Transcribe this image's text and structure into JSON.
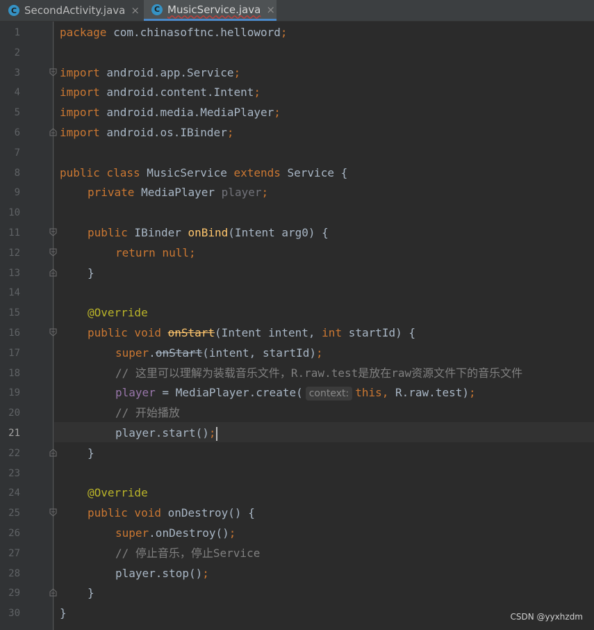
{
  "tabs": [
    {
      "label": "SecondActivity.java",
      "icon": "java-class-icon",
      "icon_letter": "C",
      "close": "×",
      "active": false
    },
    {
      "label": "MusicService.java",
      "icon": "java-class-icon",
      "icon_letter": "C",
      "close": "×",
      "active": true
    }
  ],
  "current_line": 21,
  "line_numbers": [
    "1",
    "2",
    "3",
    "4",
    "5",
    "6",
    "7",
    "8",
    "9",
    "10",
    "11",
    "12",
    "13",
    "14",
    "15",
    "16",
    "17",
    "18",
    "19",
    "20",
    "21",
    "22",
    "23",
    "24",
    "25",
    "26",
    "27",
    "28",
    "29",
    "30"
  ],
  "code": {
    "l1": [
      "package",
      " com.chinasoftnc.helloword",
      ";"
    ],
    "l3": [
      "import",
      " android.app.Service",
      ";"
    ],
    "l4": [
      "import",
      " android.content.Intent",
      ";"
    ],
    "l5": [
      "import",
      " android.media.MediaPlayer",
      ";"
    ],
    "l6": [
      "import",
      " android.os.IBinder",
      ";"
    ],
    "l8": [
      "public class",
      " MusicService ",
      "extends",
      " Service {"
    ],
    "l9": [
      "private",
      " MediaPlayer ",
      "player",
      ";"
    ],
    "l11": [
      "public",
      " IBinder ",
      "onBind",
      "(Intent arg0) {"
    ],
    "l12": [
      "return null;"
    ],
    "l13": [
      "}"
    ],
    "l15": [
      "@Override"
    ],
    "l16": [
      "public void",
      " ",
      "onStart",
      "(Intent intent, ",
      "int",
      " startId) {"
    ],
    "l17": [
      "super",
      ".",
      "onStart",
      "(intent, startId)",
      ";"
    ],
    "l18": [
      "// 这里可以理解为装载音乐文件，R.raw.test是放在raw资源文件下的音乐文件"
    ],
    "l19": [
      "player",
      " = MediaPlayer.create(",
      "context:",
      "this,",
      " R.raw.test)",
      ";"
    ],
    "l20": [
      "// 开始播放"
    ],
    "l21": [
      "player.start()",
      ";"
    ],
    "l22": [
      "}"
    ],
    "l24": [
      "@Override"
    ],
    "l25": [
      "public void",
      " onDestroy() {"
    ],
    "l26": [
      "super",
      ".onDestroy()",
      ";"
    ],
    "l27": [
      "// 停止音乐，停止Service"
    ],
    "l28": [
      "player.stop()",
      ";"
    ],
    "l29": [
      "}"
    ],
    "l30": [
      "}"
    ]
  },
  "watermark": "CSDN @yyxhzdm",
  "colors": {
    "background": "#2B2B2B",
    "gutter": "#313335",
    "keyword": "#CC7832",
    "method_decl": "#FFC66D",
    "field": "#9876AA",
    "annotation": "#BBB529",
    "comment": "#808080",
    "text": "#A9B7C6",
    "tab_underline": "#4A88C7"
  }
}
